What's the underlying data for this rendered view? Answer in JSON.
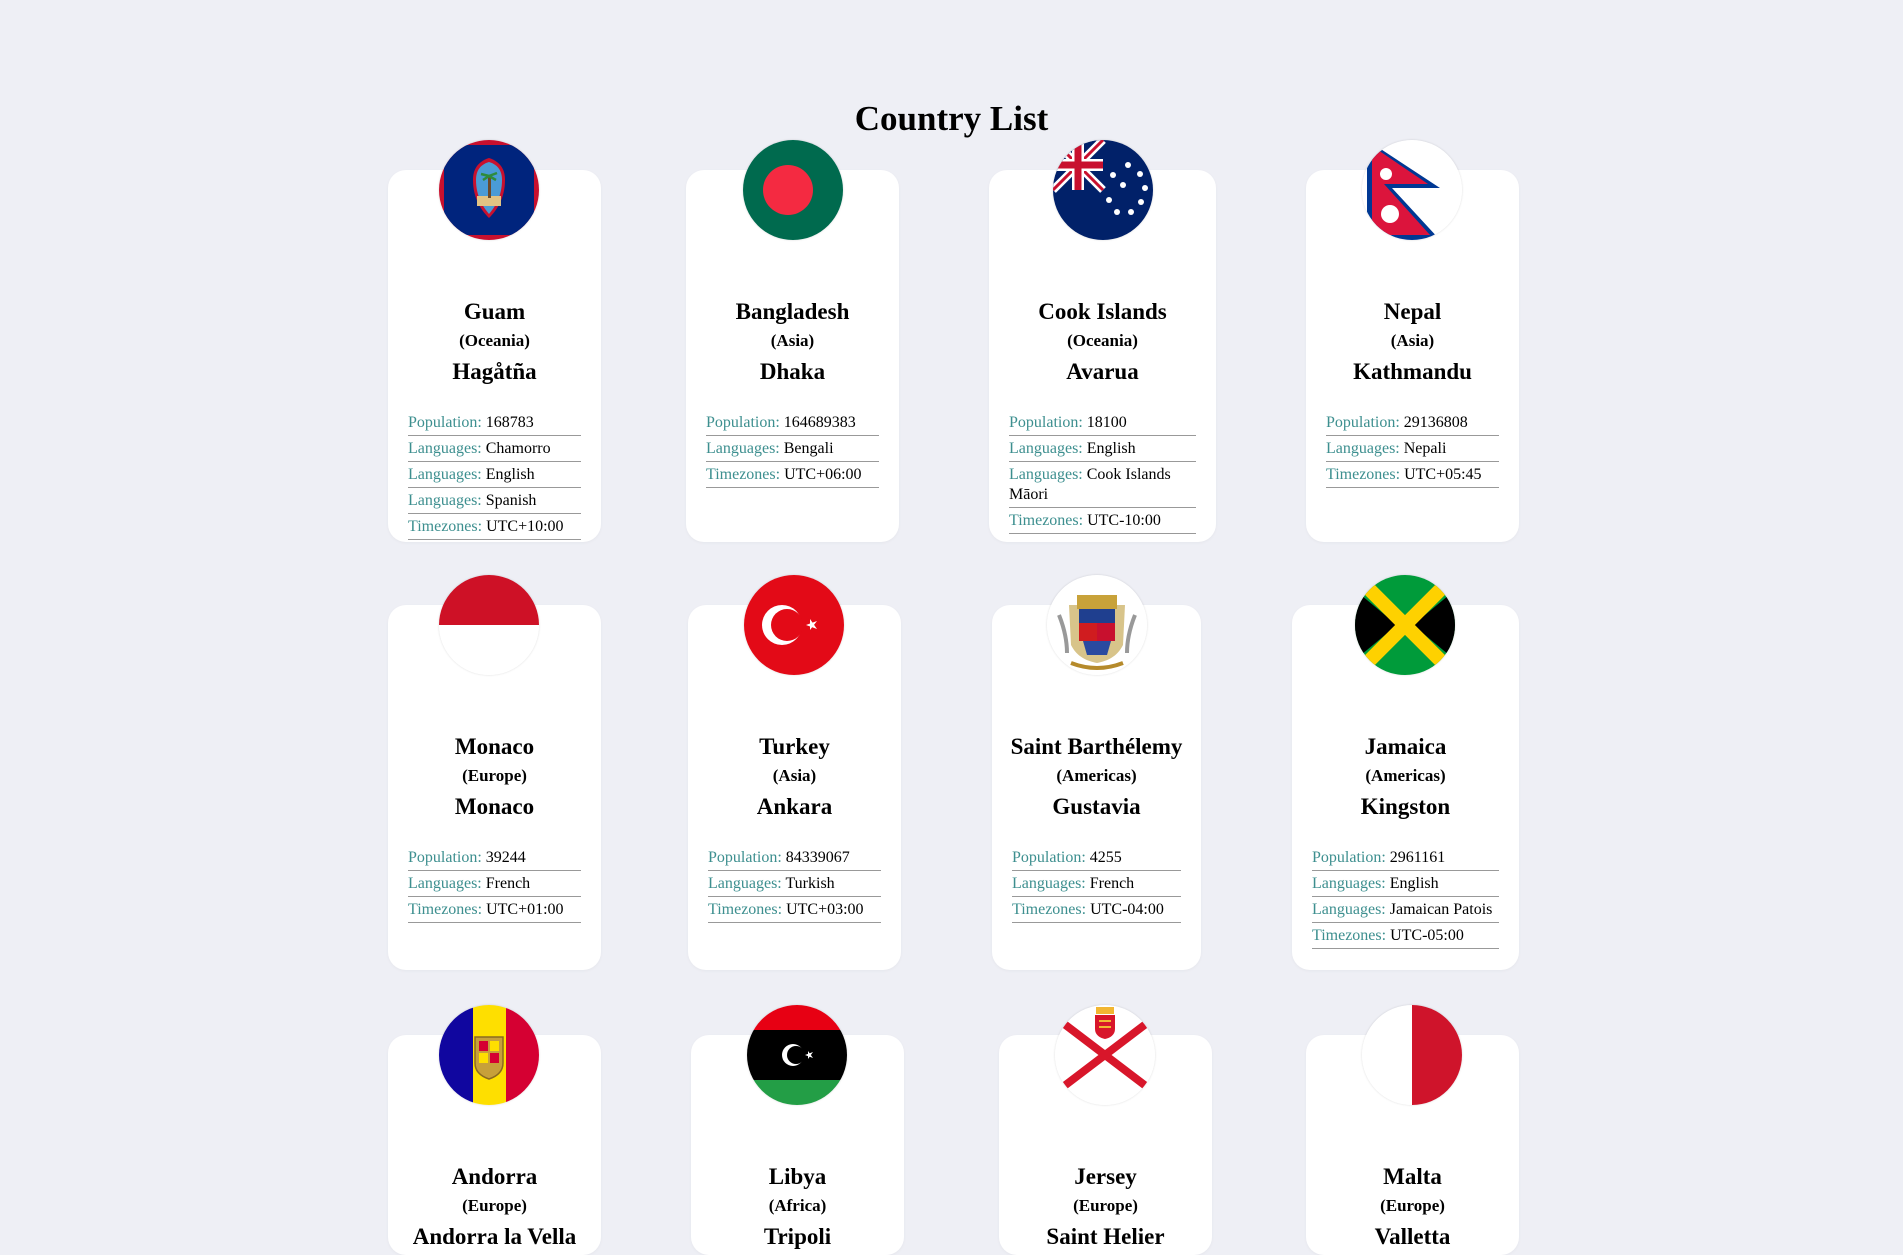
{
  "page": {
    "title": "Country List"
  },
  "countries": [
    {
      "name": "Guam",
      "region": "(Oceania)",
      "capital": "Hagåtña",
      "flag_icon": "guam-flag-icon",
      "stats": [
        {
          "label": "Population:",
          "value": "168783"
        },
        {
          "label": "Languages:",
          "value": "Chamorro"
        },
        {
          "label": "Languages:",
          "value": "English"
        },
        {
          "label": "Languages:",
          "value": "Spanish"
        },
        {
          "label": "Timezones:",
          "value": "UTC+10:00"
        }
      ]
    },
    {
      "name": "Bangladesh",
      "region": "(Asia)",
      "capital": "Dhaka",
      "flag_icon": "bangladesh-flag-icon",
      "stats": [
        {
          "label": "Population:",
          "value": "164689383"
        },
        {
          "label": "Languages:",
          "value": "Bengali"
        },
        {
          "label": "Timezones:",
          "value": "UTC+06:00"
        }
      ]
    },
    {
      "name": "Cook Islands",
      "region": "(Oceania)",
      "capital": "Avarua",
      "flag_icon": "cook-islands-flag-icon",
      "stats": [
        {
          "label": "Population:",
          "value": "18100"
        },
        {
          "label": "Languages:",
          "value": "English"
        },
        {
          "label": "Languages:",
          "value": "Cook Islands Māori"
        },
        {
          "label": "Timezones:",
          "value": "UTC-10:00"
        }
      ]
    },
    {
      "name": "Nepal",
      "region": "(Asia)",
      "capital": "Kathmandu",
      "flag_icon": "nepal-flag-icon",
      "stats": [
        {
          "label": "Population:",
          "value": "29136808"
        },
        {
          "label": "Languages:",
          "value": "Nepali"
        },
        {
          "label": "Timezones:",
          "value": "UTC+05:45"
        }
      ]
    },
    {
      "name": "Monaco",
      "region": "(Europe)",
      "capital": "Monaco",
      "flag_icon": "monaco-flag-icon",
      "stats": [
        {
          "label": "Population:",
          "value": "39244"
        },
        {
          "label": "Languages:",
          "value": "French"
        },
        {
          "label": "Timezones:",
          "value": "UTC+01:00"
        }
      ]
    },
    {
      "name": "Turkey",
      "region": "(Asia)",
      "capital": "Ankara",
      "flag_icon": "turkey-flag-icon",
      "stats": [
        {
          "label": "Population:",
          "value": "84339067"
        },
        {
          "label": "Languages:",
          "value": "Turkish"
        },
        {
          "label": "Timezones:",
          "value": "UTC+03:00"
        }
      ]
    },
    {
      "name": "Saint Barthélemy",
      "region": "(Americas)",
      "capital": "Gustavia",
      "flag_icon": "saint-barthelemy-flag-icon",
      "stats": [
        {
          "label": "Population:",
          "value": "4255"
        },
        {
          "label": "Languages:",
          "value": "French"
        },
        {
          "label": "Timezones:",
          "value": "UTC-04:00"
        }
      ]
    },
    {
      "name": "Jamaica",
      "region": "(Americas)",
      "capital": "Kingston",
      "flag_icon": "jamaica-flag-icon",
      "stats": [
        {
          "label": "Population:",
          "value": "2961161"
        },
        {
          "label": "Languages:",
          "value": "English"
        },
        {
          "label": "Languages:",
          "value": "Jamaican Patois"
        },
        {
          "label": "Timezones:",
          "value": "UTC-05:00"
        }
      ]
    },
    {
      "name": "Andorra",
      "region": "(Europe)",
      "capital": "Andorra la Vella",
      "flag_icon": "andorra-flag-icon",
      "stats": []
    },
    {
      "name": "Libya",
      "region": "(Africa)",
      "capital": "Tripoli",
      "flag_icon": "libya-flag-icon",
      "stats": []
    },
    {
      "name": "Jersey",
      "region": "(Europe)",
      "capital": "Saint Helier",
      "flag_icon": "jersey-flag-icon",
      "stats": []
    },
    {
      "name": "Malta",
      "region": "(Europe)",
      "capital": "Valletta",
      "flag_icon": "malta-flag-icon",
      "stats": []
    }
  ]
}
